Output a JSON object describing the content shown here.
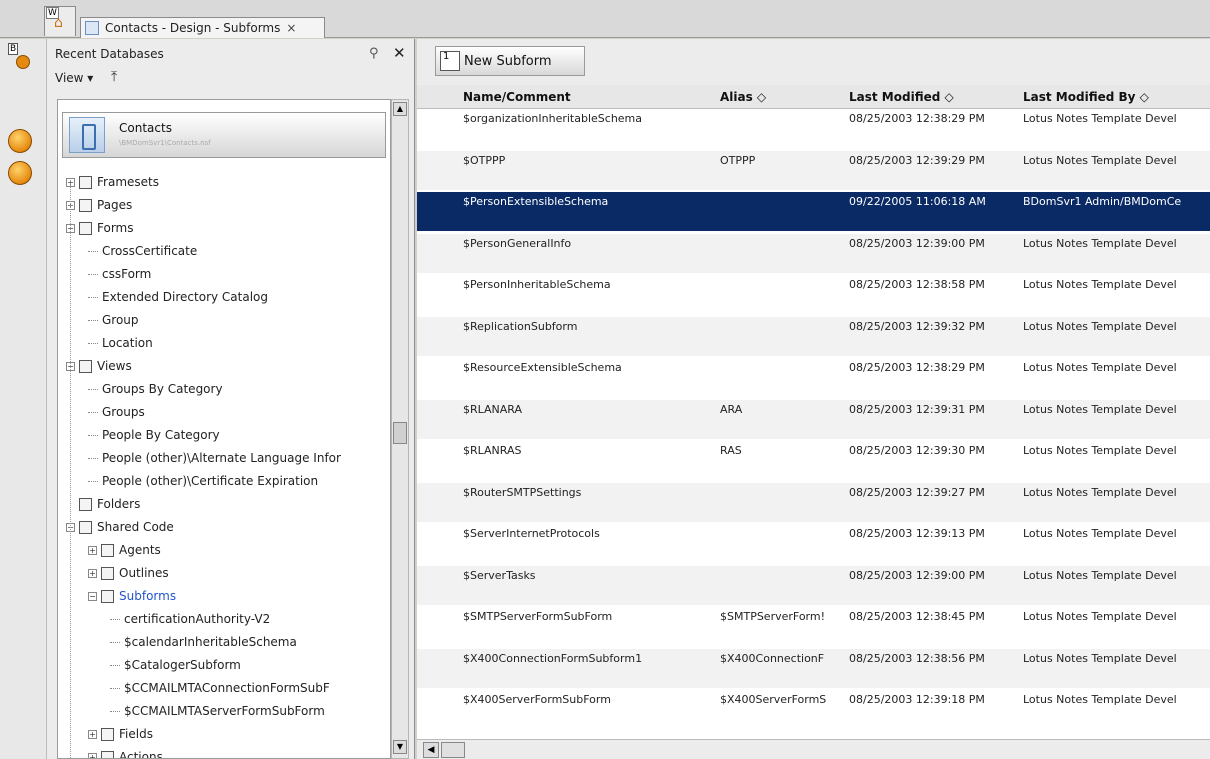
{
  "tab": {
    "home_badge": "W",
    "title": "Contacts - Design - Subforms",
    "close": "×"
  },
  "rail": {
    "db_badge": "B"
  },
  "panel": {
    "title": "Recent Databases",
    "view_label": "View ▾",
    "database": {
      "name": "Contacts",
      "path": "\\BMDomSvr1\\Contacts.nsf"
    },
    "tree": [
      {
        "label": "Framesets",
        "level": 0,
        "expander": "+",
        "icon": "frameset-icon"
      },
      {
        "label": "Pages",
        "level": 0,
        "expander": "+",
        "icon": "page-icon"
      },
      {
        "label": "Forms",
        "level": 0,
        "expander": "−",
        "icon": "form-icon"
      },
      {
        "label": "CrossCertificate",
        "level": 1
      },
      {
        "label": "cssForm",
        "level": 1
      },
      {
        "label": "Extended Directory Catalog",
        "level": 1
      },
      {
        "label": "Group",
        "level": 1
      },
      {
        "label": "Location",
        "level": 1
      },
      {
        "label": "Views",
        "level": 0,
        "expander": "−",
        "icon": "view-icon"
      },
      {
        "label": "Groups By Category",
        "level": 1
      },
      {
        "label": "Groups",
        "level": 1
      },
      {
        "label": "People By Category",
        "level": 1
      },
      {
        "label": "People (other)\\Alternate Language Infor",
        "level": 1
      },
      {
        "label": "People (other)\\Certificate Expiration",
        "level": 1
      },
      {
        "label": "Folders",
        "level": 0,
        "expander": "",
        "icon": "folder-icon"
      },
      {
        "label": "Shared Code",
        "level": 0,
        "expander": "−",
        "icon": "shared-code-icon"
      },
      {
        "label": "Agents",
        "level": 1,
        "expander": "+",
        "icon": "agent-icon"
      },
      {
        "label": "Outlines",
        "level": 1,
        "expander": "+",
        "icon": "outline-icon"
      },
      {
        "label": "Subforms",
        "level": 1,
        "expander": "−",
        "icon": "subform-icon",
        "selected": true
      },
      {
        "label": "certificationAuthority-V2",
        "level": 2
      },
      {
        "label": "$calendarInheritableSchema",
        "level": 2
      },
      {
        "label": "$CatalogerSubform",
        "level": 2
      },
      {
        "label": "$CCMAILMTAConnectionFormSubF",
        "level": 2
      },
      {
        "label": "$CCMAILMTAServerFormSubForm",
        "level": 2
      },
      {
        "label": "Fields",
        "level": 1,
        "expander": "+",
        "icon": "field-icon"
      },
      {
        "label": "Actions",
        "level": 1,
        "expander": "+",
        "icon": "action-icon"
      }
    ]
  },
  "toolbar": {
    "new_subform_label": "New Subform",
    "new_subform_icon_badge": "1"
  },
  "grid": {
    "columns": [
      "Name/Comment",
      "Alias ◇",
      "Last Modified ◇",
      "Last Modified By ◇"
    ],
    "rows": [
      {
        "name": "$organizationInheritableSchema",
        "alias": "",
        "modified": "08/25/2003 12:38:29 PM",
        "by": "Lotus Notes Template Devel"
      },
      {
        "name": "$OTPPP",
        "alias": "OTPPP",
        "modified": "08/25/2003 12:39:29 PM",
        "by": "Lotus Notes Template Devel"
      },
      {
        "name": "$PersonExtensibleSchema",
        "alias": "",
        "modified": "09/22/2005 11:06:18 AM",
        "by": "BDomSvr1 Admin/BMDomCe"
      },
      {
        "name": "$PersonGeneralInfo",
        "alias": "",
        "modified": "08/25/2003 12:39:00 PM",
        "by": "Lotus Notes Template Devel"
      },
      {
        "name": "$PersonInheritableSchema",
        "alias": "",
        "modified": "08/25/2003 12:38:58 PM",
        "by": "Lotus Notes Template Devel"
      },
      {
        "name": "$ReplicationSubform",
        "alias": "",
        "modified": "08/25/2003 12:39:32 PM",
        "by": "Lotus Notes Template Devel"
      },
      {
        "name": "$ResourceExtensibleSchema",
        "alias": "",
        "modified": "08/25/2003 12:38:29 PM",
        "by": "Lotus Notes Template Devel"
      },
      {
        "name": "$RLANARA",
        "alias": "ARA",
        "modified": "08/25/2003 12:39:31 PM",
        "by": "Lotus Notes Template Devel"
      },
      {
        "name": "$RLANRAS",
        "alias": "RAS",
        "modified": "08/25/2003 12:39:30 PM",
        "by": "Lotus Notes Template Devel"
      },
      {
        "name": "$RouterSMTPSettings",
        "alias": "",
        "modified": "08/25/2003 12:39:27 PM",
        "by": "Lotus Notes Template Devel"
      },
      {
        "name": "$ServerInternetProtocols",
        "alias": "",
        "modified": "08/25/2003 12:39:13 PM",
        "by": "Lotus Notes Template Devel"
      },
      {
        "name": "$ServerTasks",
        "alias": "",
        "modified": "08/25/2003 12:39:00 PM",
        "by": "Lotus Notes Template Devel"
      },
      {
        "name": "$SMTPServerFormSubForm",
        "alias": "$SMTPServerForm!",
        "modified": "08/25/2003 12:38:45 PM",
        "by": "Lotus Notes Template Devel"
      },
      {
        "name": "$X400ConnectionFormSubform1",
        "alias": "$X400ConnectionF",
        "modified": "08/25/2003 12:38:56 PM",
        "by": "Lotus Notes Template Devel"
      },
      {
        "name": "$X400ServerFormSubForm",
        "alias": "$X400ServerFormS",
        "modified": "08/25/2003 12:39:18 PM",
        "by": "Lotus Notes Template Devel"
      }
    ],
    "selected_index": 2
  },
  "colors": {
    "selection": "#0a2a66",
    "tree_selected_text": "#2255cc"
  }
}
